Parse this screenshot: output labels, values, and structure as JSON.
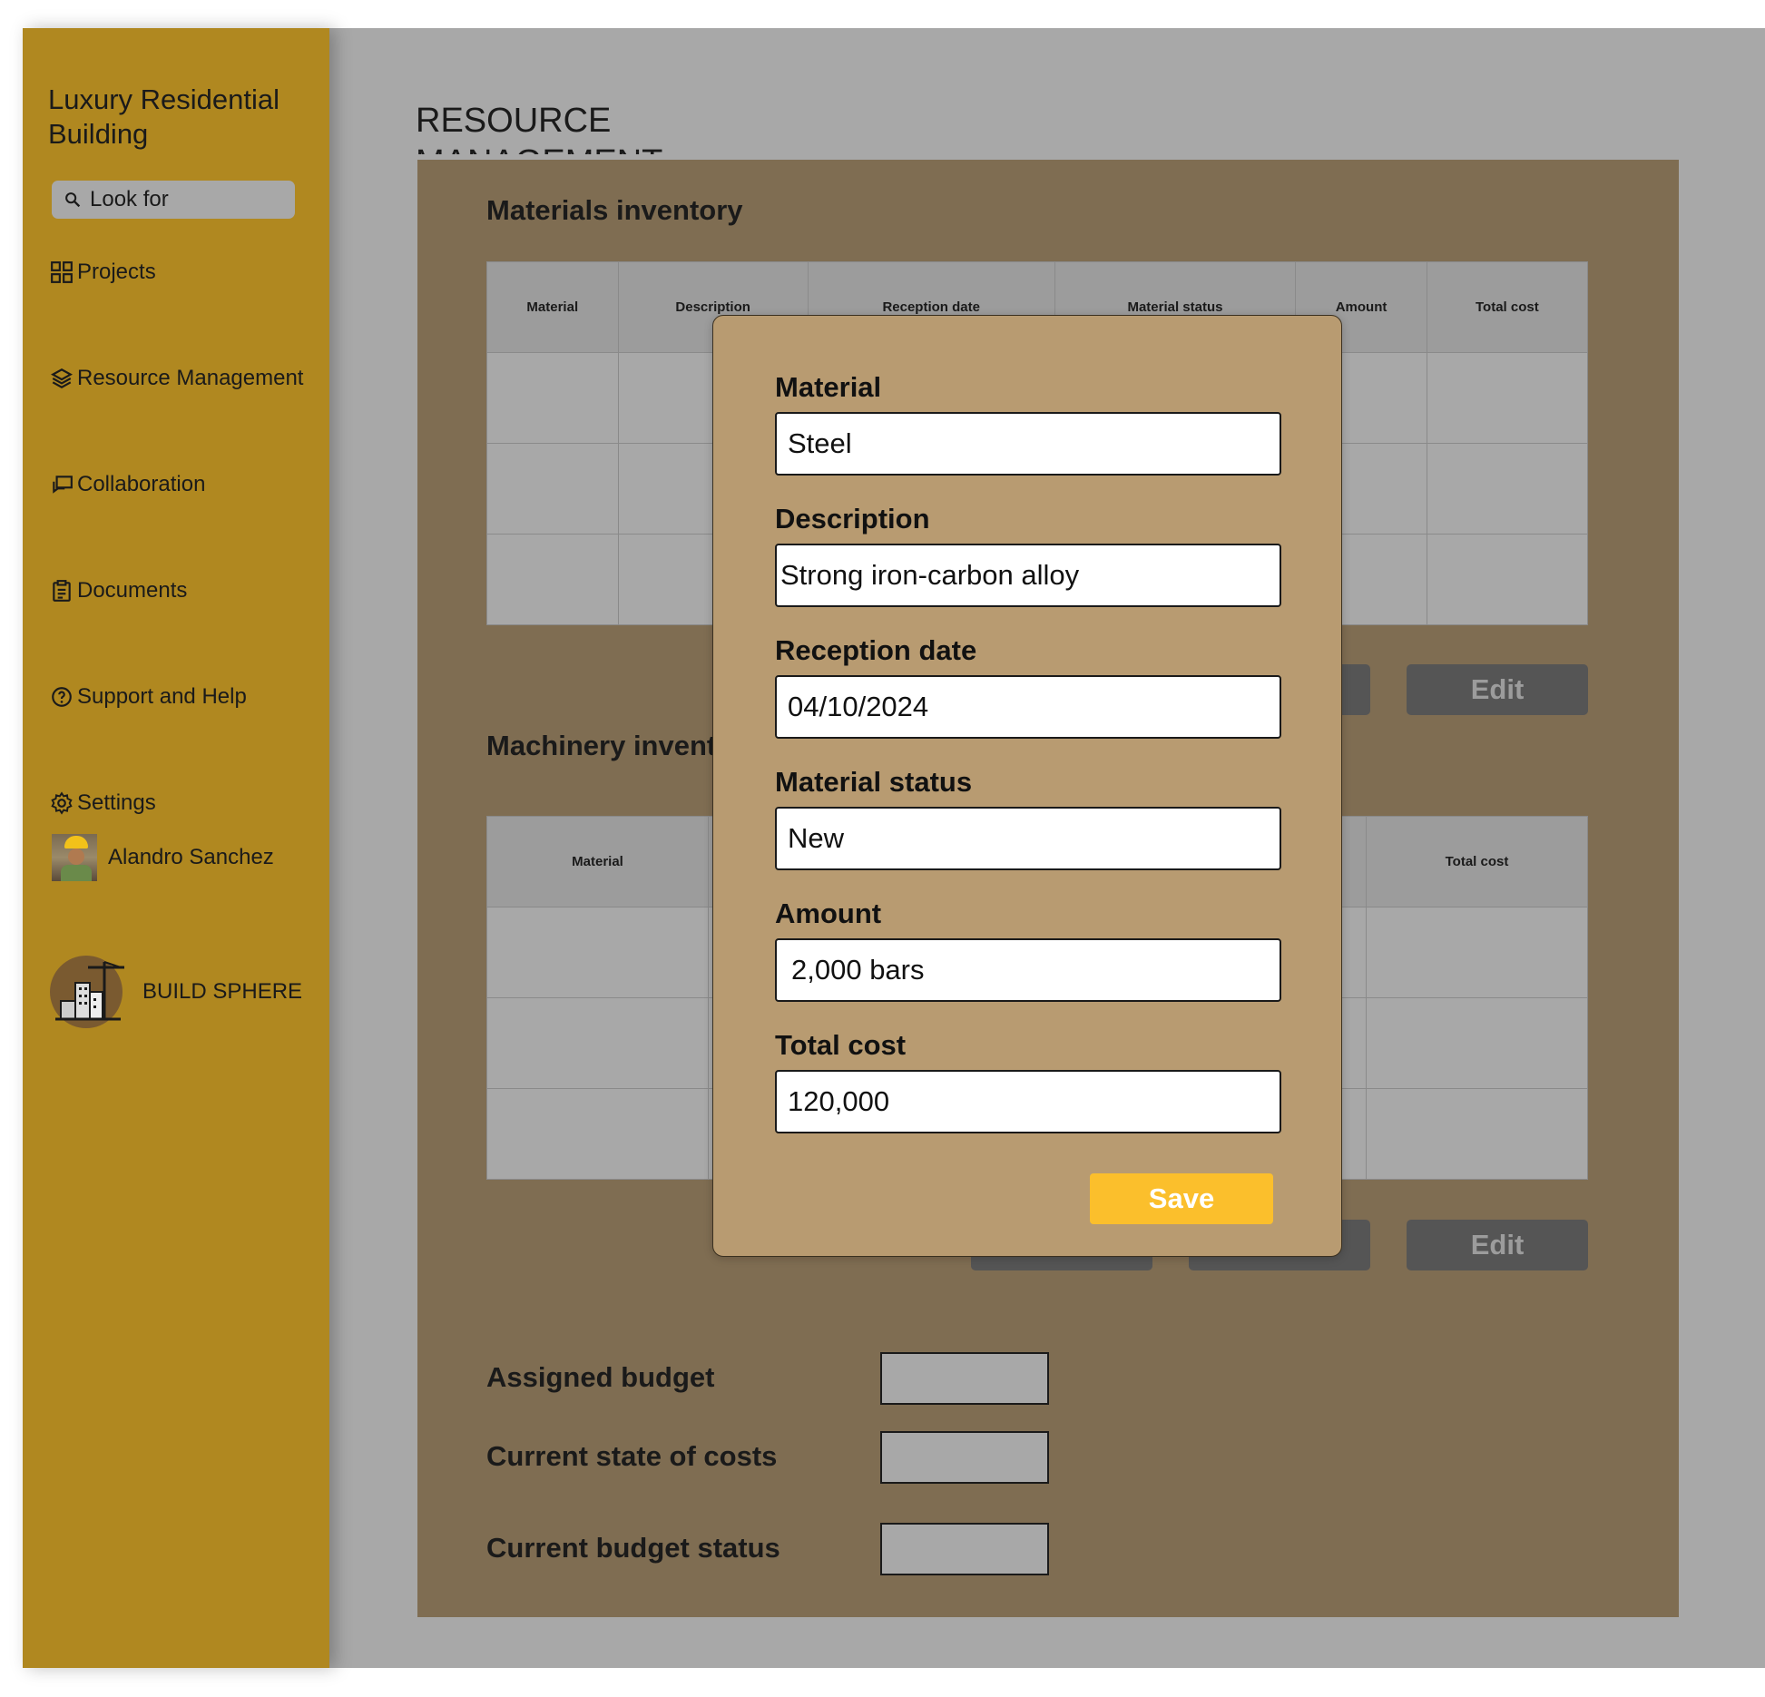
{
  "sidebar": {
    "title": "Luxury Residential Building",
    "search_placeholder": "Look for",
    "items": [
      {
        "label": "Projects",
        "icon": "grid-icon"
      },
      {
        "label": "Resource Management",
        "icon": "layers-icon"
      },
      {
        "label": "Collaboration",
        "icon": "chat-icon"
      },
      {
        "label": "Documents",
        "icon": "document-icon"
      },
      {
        "label": "Support and Help",
        "icon": "help-icon"
      },
      {
        "label": "Settings",
        "icon": "gear-icon"
      }
    ],
    "user_name": "Alandro Sanchez",
    "brand": "BUILD SPHERE"
  },
  "main": {
    "page_title": "RESOURCE MANAGEMENT",
    "materials": {
      "title": "Materials inventory",
      "columns": [
        "Material",
        "Description",
        "Reception date",
        "Material status",
        "Amount",
        "Total cost"
      ],
      "edit_label": "Edit"
    },
    "machinery": {
      "title": "Machinery invent",
      "columns": [
        "Material",
        "Total cost"
      ],
      "edit_label": "Edit"
    },
    "budget": {
      "assigned": "Assigned budget",
      "current_costs": "Current state of costs",
      "status": "Current budget status"
    }
  },
  "modal": {
    "fields": [
      {
        "label": "Material",
        "value": "Steel"
      },
      {
        "label": "Description",
        "value": "Strong iron-carbon alloy"
      },
      {
        "label": "Reception date",
        "value": "04/10/2024"
      },
      {
        "label": "Material status",
        "value": "New"
      },
      {
        "label": "Amount",
        "value": "2,000 bars"
      },
      {
        "label": "Total cost",
        "value": "120,000"
      }
    ],
    "save_label": "Save"
  },
  "colors": {
    "sidebar": "#b08820",
    "panel": "#7f6d52",
    "modal": "#b89b71",
    "save": "#fbbf2c"
  }
}
